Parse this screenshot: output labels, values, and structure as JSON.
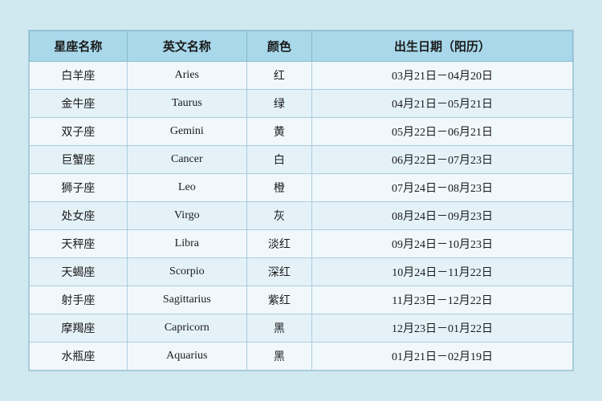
{
  "table": {
    "headers": {
      "col1": "星座名称",
      "col2": "英文名称",
      "col3": "颜色",
      "col4": "出生日期（阳历）"
    },
    "rows": [
      {
        "cn": "白羊座",
        "en": "Aries",
        "color": "红",
        "date": "03月21日－04月20日"
      },
      {
        "cn": "金牛座",
        "en": "Taurus",
        "color": "绿",
        "date": "04月21日－05月21日"
      },
      {
        "cn": "双子座",
        "en": "Gemini",
        "color": "黄",
        "date": "05月22日－06月21日"
      },
      {
        "cn": "巨蟹座",
        "en": "Cancer",
        "color": "白",
        "date": "06月22日－07月23日"
      },
      {
        "cn": "狮子座",
        "en": "Leo",
        "color": "橙",
        "date": "07月24日－08月23日"
      },
      {
        "cn": "处女座",
        "en": "Virgo",
        "color": "灰",
        "date": "08月24日－09月23日"
      },
      {
        "cn": "天秤座",
        "en": "Libra",
        "color": "淡红",
        "date": "09月24日－10月23日"
      },
      {
        "cn": "天蝎座",
        "en": "Scorpio",
        "color": "深红",
        "date": "10月24日－11月22日"
      },
      {
        "cn": "射手座",
        "en": "Sagittarius",
        "color": "紫红",
        "date": "11月23日－12月22日"
      },
      {
        "cn": "摩羯座",
        "en": "Capricorn",
        "color": "黑",
        "date": "12月23日－01月22日"
      },
      {
        "cn": "水瓶座",
        "en": "Aquarius",
        "color": "黑",
        "date": "01月21日－02月19日"
      }
    ]
  }
}
